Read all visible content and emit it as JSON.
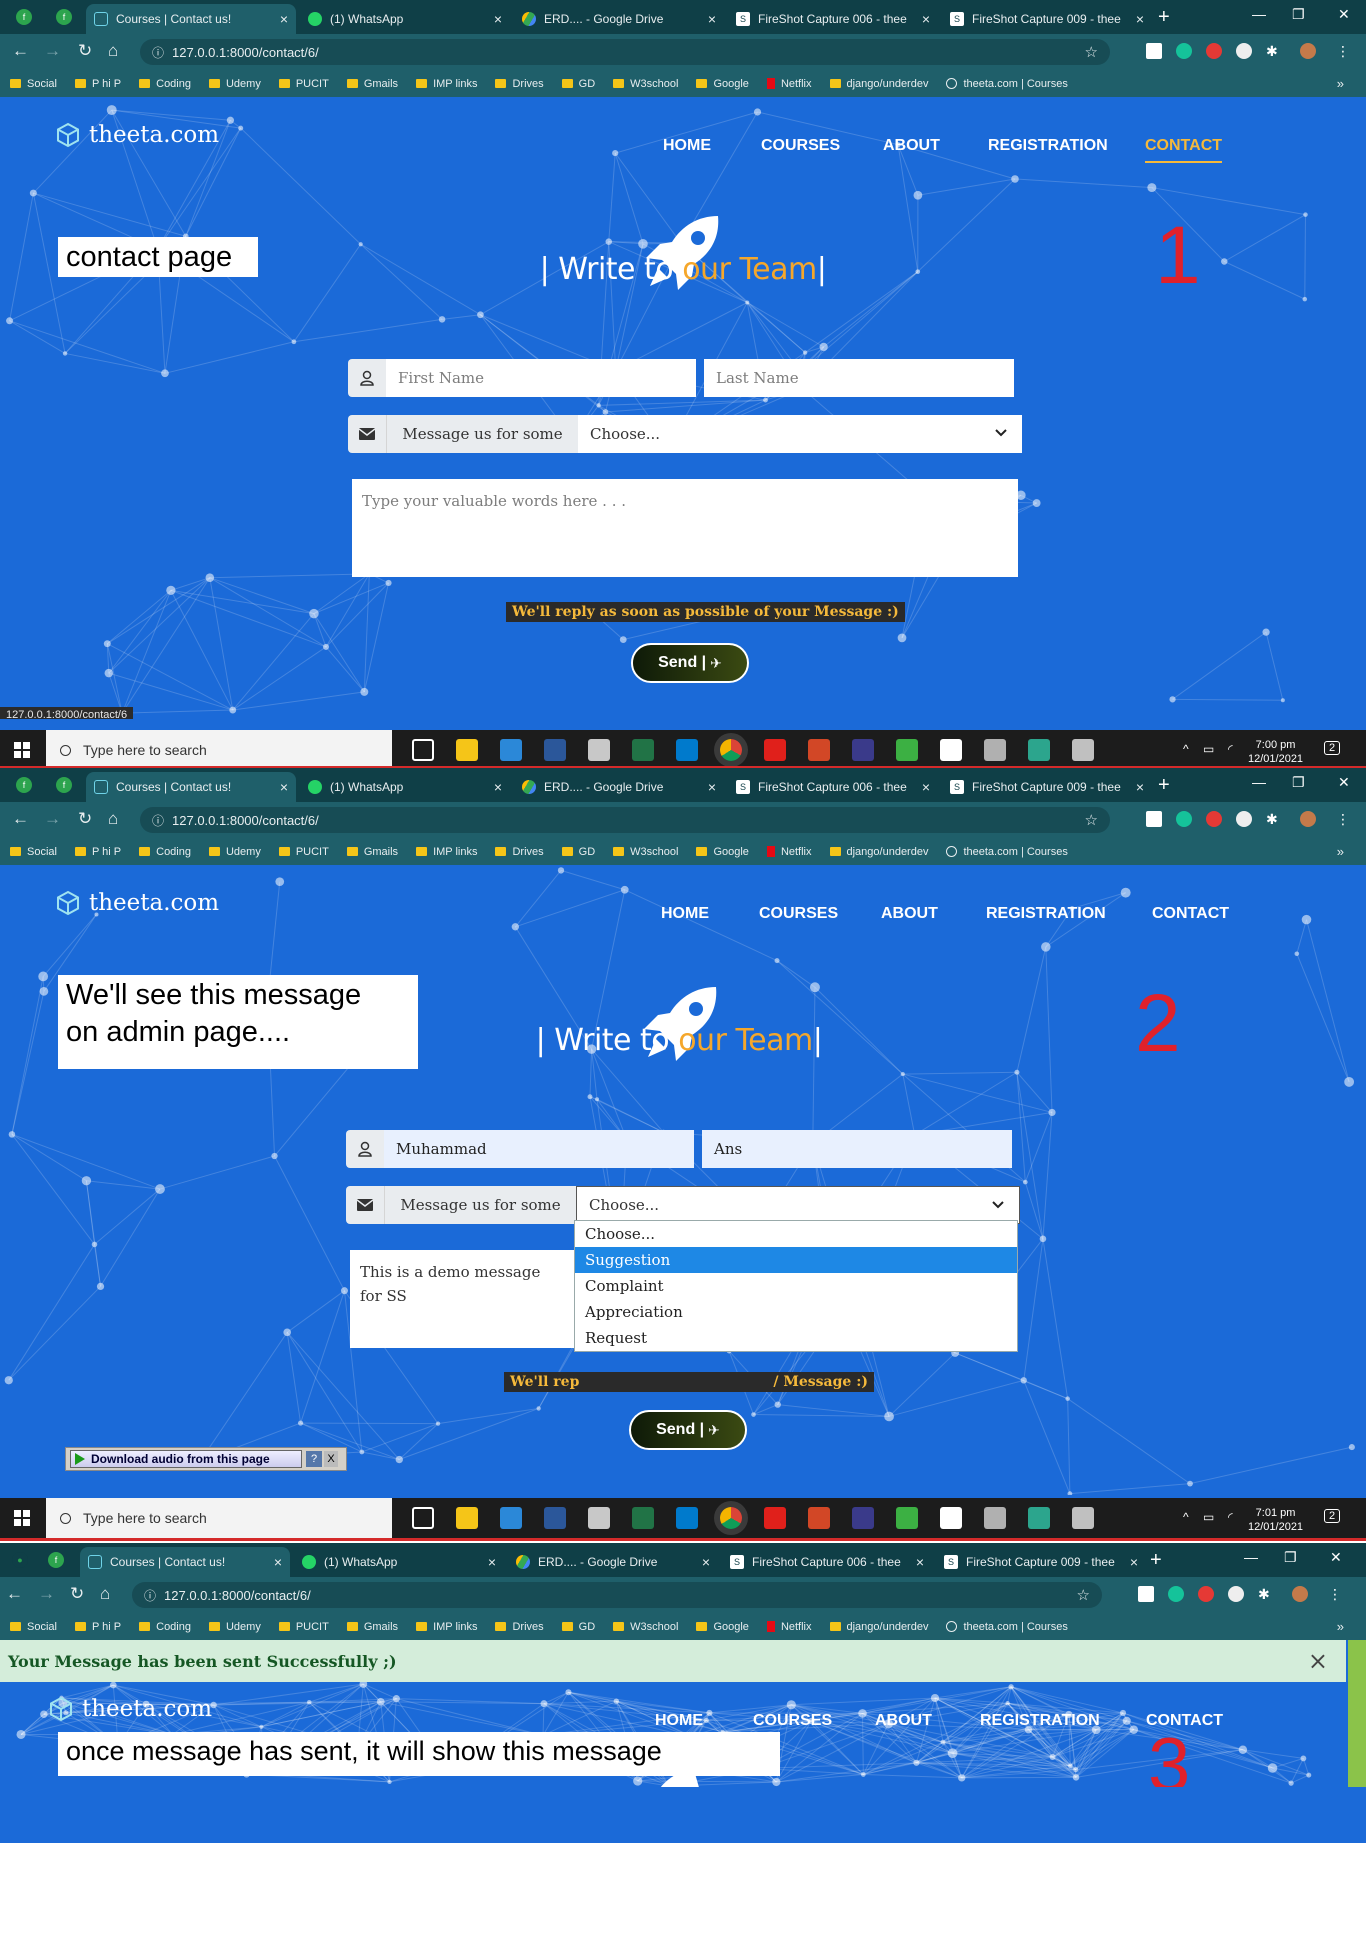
{
  "browser": {
    "tabs": [
      {
        "label": "Courses | Contact us!",
        "active": true
      },
      {
        "label": "(1) WhatsApp"
      },
      {
        "label": "ERD.... - Google Drive"
      },
      {
        "label": "FireShot Capture 006 - thee"
      },
      {
        "label": "FireShot Capture 009 - thee"
      }
    ],
    "new_tab": "+",
    "url": "127.0.0.1:8000/contact/6/",
    "bookmarks": [
      "Social",
      "P hi P",
      "Coding",
      "Udemy",
      "PUCIT",
      "Gmails",
      "IMP links",
      "Drives",
      "GD",
      "W3school",
      "Google",
      "Netflix",
      "django/underdev",
      "theeta.com | Courses"
    ],
    "bookmarks_more": "»"
  },
  "site": {
    "brand": "theeta.com",
    "nav": [
      "HOME",
      "COURSES",
      "ABOUT",
      "REGISTRATION",
      "CONTACT"
    ],
    "heading_pre": "| Write to ",
    "heading_hl": "our Team",
    "heading_post": "|",
    "first_name_placeholder": "First Name",
    "last_name_placeholder": "Last Name",
    "message_addon": "Message us for some",
    "select_value": "Choose...",
    "textarea_placeholder": "Type your valuable words here . . .",
    "reply_note": "We'll reply as soon as possible of your Message :)",
    "send_label": "Send |"
  },
  "panel1": {
    "note": "contact page",
    "number": "1",
    "status_url": "127.0.0.1:8000/contact/6",
    "time": "7:00 pm",
    "date": "12/01/2021"
  },
  "panel2": {
    "note_line1": "We'll see this message",
    "note_line2": "on admin page....",
    "number": "2",
    "first_name": "Muhammad",
    "last_name": "Ans",
    "message_line1": "This is a demo message",
    "message_line2": "for SS",
    "reply_partial_1": "We'll rep",
    "reply_partial_2": "/ Message :)",
    "options": [
      "Choose...",
      "Suggestion",
      "Complaint",
      "Appreciation",
      "Request"
    ],
    "selected_option": "Suggestion",
    "download_bar": "Download audio from this page",
    "download_help": "?",
    "download_close": "X",
    "time": "7:01 pm",
    "date": "12/01/2021"
  },
  "panel3": {
    "alert": "Your Message has been sent Successfully ;)",
    "alert_close": "×",
    "note": "once message has sent, it will show this message",
    "number": "3"
  },
  "taskbar": {
    "search_placeholder": "Type here to search",
    "notif_count": "2"
  },
  "colors": {
    "site_bg": "#1b6ad8",
    "accent": "#f5a72b",
    "chrome_dark": "#0f3f47",
    "chrome_toolbar": "#1f5f6a",
    "annotation_red": "#e0212b",
    "alert_bg": "#d4edda"
  }
}
